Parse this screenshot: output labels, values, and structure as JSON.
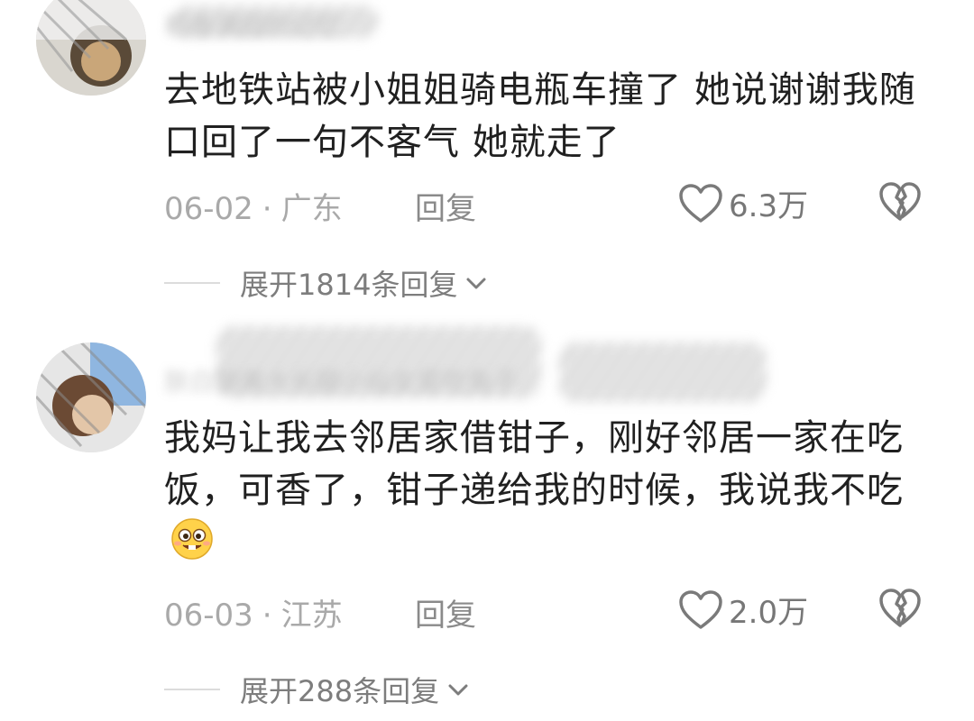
{
  "comments": [
    {
      "username": "稻香满园的记忆",
      "text": "去地铁站被小姐姐骑电瓶车撞了  她说谢谢我随口回了一句不客气  她就走了",
      "date": "06-02",
      "dot": "·",
      "location": "广东",
      "reply_label": "回复",
      "like_count": "6.3万",
      "expand_label": "展开1814条回复"
    },
    {
      "username": "肤白貌美大长腿小仙女爱吃兔子",
      "text": "我妈让我去邻居家借钳子，刚好邻居一家在吃饭，可香了，钳子递给我的时候，我说我不吃",
      "emoji": "drooling-face",
      "date": "06-03",
      "dot": "·",
      "location": "江苏",
      "reply_label": "回复",
      "like_count": "2.0万",
      "expand_label": "展开288条回复"
    }
  ],
  "icons": {
    "like": "heart-outline-icon",
    "dislike": "broken-heart-icon",
    "expand": "chevron-down-icon"
  }
}
